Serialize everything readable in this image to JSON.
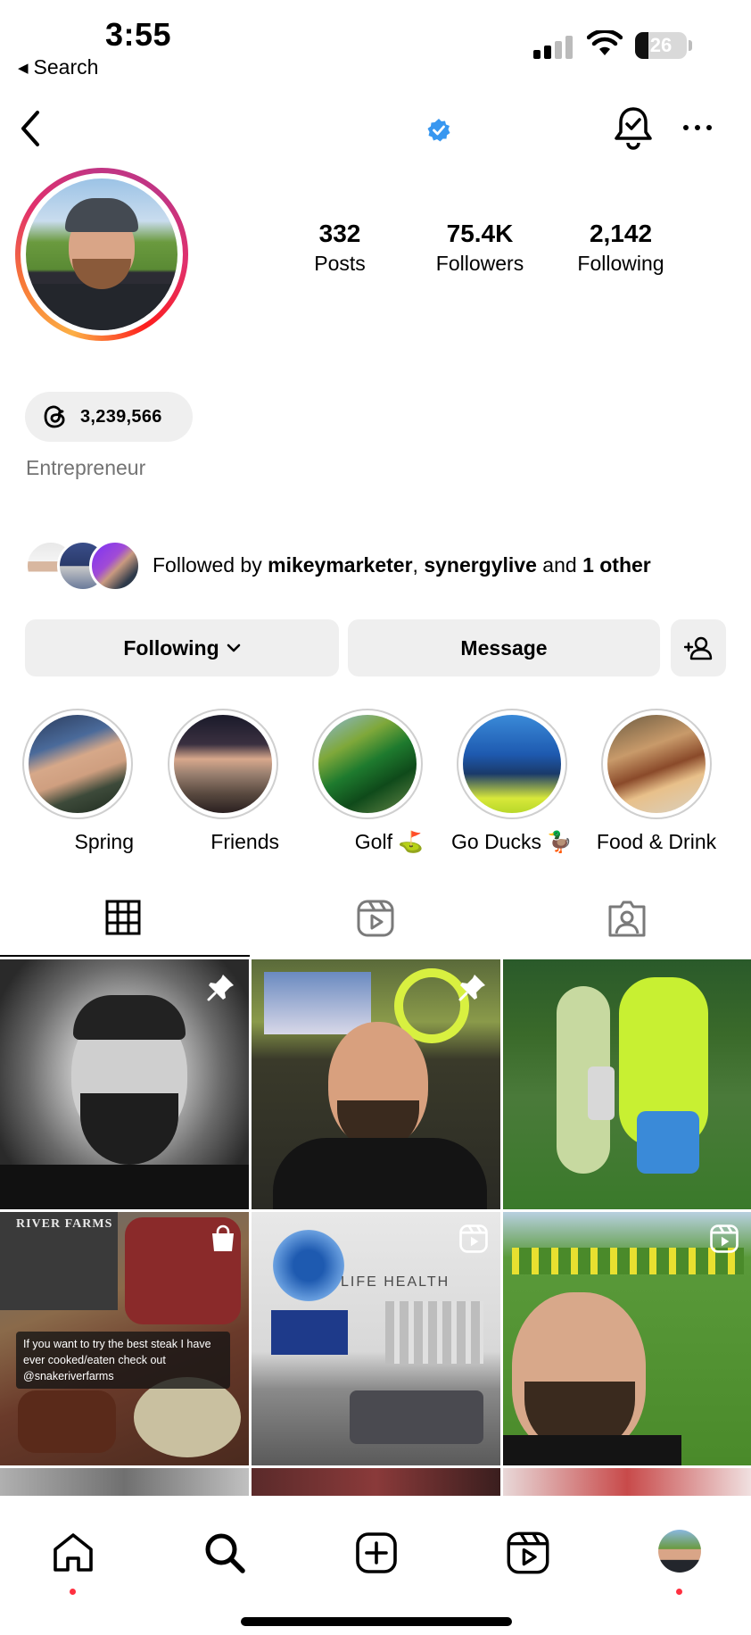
{
  "status_bar": {
    "time": "3:55",
    "back_label": "Search",
    "battery": "26",
    "battery_level": 0.26
  },
  "profile": {
    "stats": [
      {
        "value": "332",
        "label": "Posts"
      },
      {
        "value": "75.4K",
        "label": "Followers"
      },
      {
        "value": "2,142",
        "label": "Following"
      }
    ],
    "threads_count": "3,239,566",
    "category": "Entrepreneur",
    "followed_by": {
      "prefix": "Followed by ",
      "user1": "mikeymarketer",
      "sep": ", ",
      "user2": "synergylive",
      "and": " and ",
      "other": "1 other"
    }
  },
  "actions": {
    "following_label": "Following",
    "message_label": "Message"
  },
  "highlights": [
    {
      "label": "Spring"
    },
    {
      "label": "Friends"
    },
    {
      "label": "Golf ⛳"
    },
    {
      "label": "Go Ducks 🦆"
    },
    {
      "label": "Food & Drink"
    }
  ],
  "grid": {
    "post_caption": "If you want to try the best steak I have ever cooked/eaten check out @snakeriverfarms",
    "post_brand": "RIVER FARMS"
  },
  "colors": {
    "verified": "#3897f0",
    "notification_dot": "#ff3040",
    "button_bg": "#efefef",
    "muted_text": "#737373"
  },
  "icons": {
    "header": [
      "back-chevron-icon",
      "verified-badge-icon",
      "bell-check-icon",
      "more-icon"
    ],
    "tabs": [
      "grid-icon",
      "reels-icon",
      "tagged-icon"
    ],
    "nav": [
      "home-icon",
      "search-icon",
      "create-icon",
      "reels-icon",
      "profile-avatar"
    ]
  }
}
